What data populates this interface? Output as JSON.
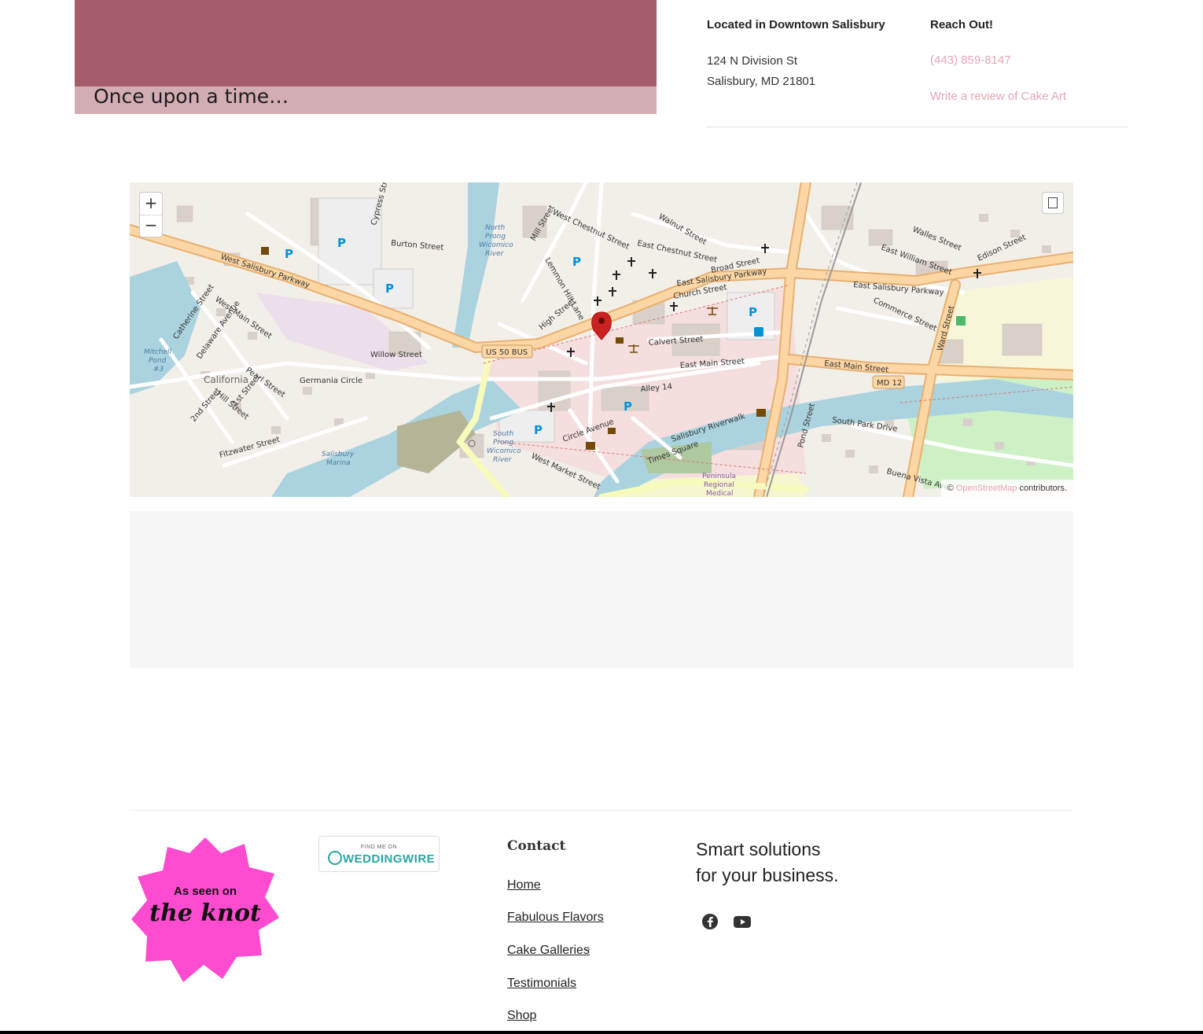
{
  "hero": {
    "caption": "Once upon a time…"
  },
  "location": {
    "heading": "Located in Downtown Salisbury",
    "address_line1": "124 N Division St",
    "address_line2": "Salisbury, MD 21801"
  },
  "reach": {
    "heading": "Reach Out!",
    "phone": "(443) 859-8147",
    "review_link": "Write a review of Cake Art"
  },
  "map": {
    "zoom_in": "+",
    "zoom_out": "−",
    "attribution_prefix": "© ",
    "attribution_link": "OpenStreetMap",
    "attribution_suffix": " contributors.",
    "labels": {
      "west_salisbury_pkwy": "West Salisbury Parkway",
      "east_salisbury_pkwy": "East Salisbury Parkway",
      "east_salisbury_pkwy_2": "East Salisbury Parkway",
      "east_main": "East Main Street",
      "east_main_2": "East Main Street",
      "us50": "US 50 BUS",
      "md12": "MD 12",
      "willow": "Willow Street",
      "germania": "Germania Circle",
      "california": "California",
      "calvert": "Calvert Street",
      "church": "Church Street",
      "broad": "Broad Street",
      "circle_ave": "Circle Avenue",
      "west_market": "West Market Street",
      "riverwalk": "Salisbury Riverwalk",
      "times_square": "Times Square",
      "burton": "Burton Street",
      "cypress": "Cypress Street",
      "high": "High Street",
      "lemmon": "Lemmon Hill Lane",
      "mill": "Mill Street",
      "west_chestnut": "West Chestnut Street",
      "east_chestnut": "East Chestnut Street",
      "walnut": "Walnut Street",
      "commerce": "Commerce Street",
      "east_william": "East William Street",
      "walles": "Walles Street",
      "edison": "Edison Street",
      "ward": "Ward Street",
      "south_park": "South Park Drive",
      "buena_vista": "Buena Vista Ave",
      "pond": "Pond Street",
      "fitzwater": "Fitzwater Street",
      "pearl": "Pearl Street",
      "delaware": "Delaware Avenue",
      "catherine": "Catherine Street",
      "west_main": "West Main Street",
      "hill": "Hill Street",
      "first": "1st Street",
      "second": "2nd Street",
      "alley14": "Alley 14",
      "north_prong_1": "North",
      "north_prong_2": "Prong",
      "north_prong_3": "Wicomico",
      "north_prong_4": "River",
      "south_prong_1": "South",
      "south_prong_2": "Prong",
      "south_prong_3": "Wicomico",
      "south_prong_4": "River",
      "mitchell_1": "Mitchell",
      "mitchell_2": "Pond",
      "mitchell_3": "#3",
      "marina_1": "Salisbury",
      "marina_2": "Marina",
      "hospital_1": "Peninsula",
      "hospital_2": "Regional",
      "hospital_3": "Medical",
      "parking": "P"
    }
  },
  "footer": {
    "badge_line1": "As seen on",
    "badge_line2": "the knot",
    "ww_small": "FIND ME ON",
    "ww_big": "WEDDINGWIRE",
    "contact_heading": "Contact",
    "nav": [
      "Home",
      "Fabulous Flavors",
      "Cake Galleries",
      "Testimonials",
      "Shop"
    ],
    "dropdown_arrow": "⌄",
    "tagline_line1": "Smart solutions",
    "tagline_line2": "for your business."
  },
  "colors": {
    "hero_dark": "#a45e69",
    "hero_light": "#d3adb4",
    "link_pink": "#e7a6b3",
    "knot_pink": "#ff4bd0"
  }
}
